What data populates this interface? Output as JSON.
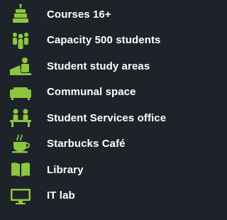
{
  "accent": "#8cc63f",
  "background": "#1e2329",
  "items": [
    {
      "icon": "cake-icon",
      "label": "Courses 16+"
    },
    {
      "icon": "people-group-icon",
      "label": "Capacity 500 students"
    },
    {
      "icon": "student-desk-icon",
      "label": "Student study areas"
    },
    {
      "icon": "sofa-icon",
      "label": "Communal space"
    },
    {
      "icon": "office-desk-icon",
      "label": "Student Services office"
    },
    {
      "icon": "coffee-cup-icon",
      "label": "Starbucks Café"
    },
    {
      "icon": "open-book-icon",
      "label": "Library"
    },
    {
      "icon": "monitor-icon",
      "label": "IT lab"
    }
  ]
}
